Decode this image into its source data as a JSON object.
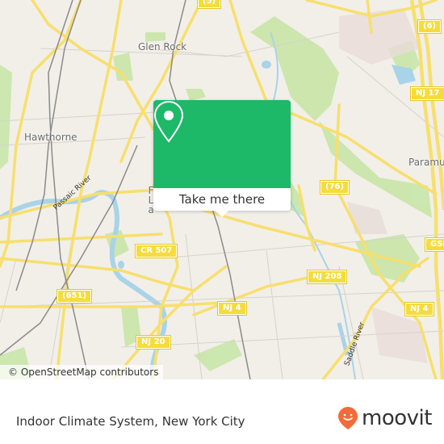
{
  "map": {
    "place_labels": [
      {
        "name": "glen-rock",
        "text": "Glen Rock"
      },
      {
        "name": "hawthorne",
        "text": "Hawthorne"
      },
      {
        "name": "paramus",
        "text": "Paramu"
      },
      {
        "name": "fair-lawn",
        "text": "F La"
      }
    ],
    "shields": [
      {
        "name": "route-6",
        "text": "(6)"
      },
      {
        "name": "nj-17",
        "text": "NJ 17"
      },
      {
        "name": "route-76",
        "text": "(76)"
      },
      {
        "name": "gsp",
        "text": "GSP"
      },
      {
        "name": "cr-507",
        "text": "CR 507"
      },
      {
        "name": "nj-208",
        "text": "NJ 208"
      },
      {
        "name": "route-651",
        "text": "(651)"
      },
      {
        "name": "nj-4-west",
        "text": "NJ 4"
      },
      {
        "name": "nj-4-east",
        "text": "NJ 4"
      },
      {
        "name": "nj-20",
        "text": "NJ 20"
      },
      {
        "name": "route-5",
        "text": "(5)"
      }
    ],
    "river_labels": [
      {
        "name": "passaic-river",
        "text": "Passaic River"
      },
      {
        "name": "saddle-river",
        "text": "Saddle River"
      }
    ],
    "attribution": "© OpenStreetMap contributors"
  },
  "popup": {
    "action_label": "Take me there",
    "icon": "map-pin-icon",
    "accent_color": "#1eb869"
  },
  "footer": {
    "title": "Indoor Climate System, New York City",
    "logo_text": "moovit",
    "logo_color": "#f26b3a"
  }
}
